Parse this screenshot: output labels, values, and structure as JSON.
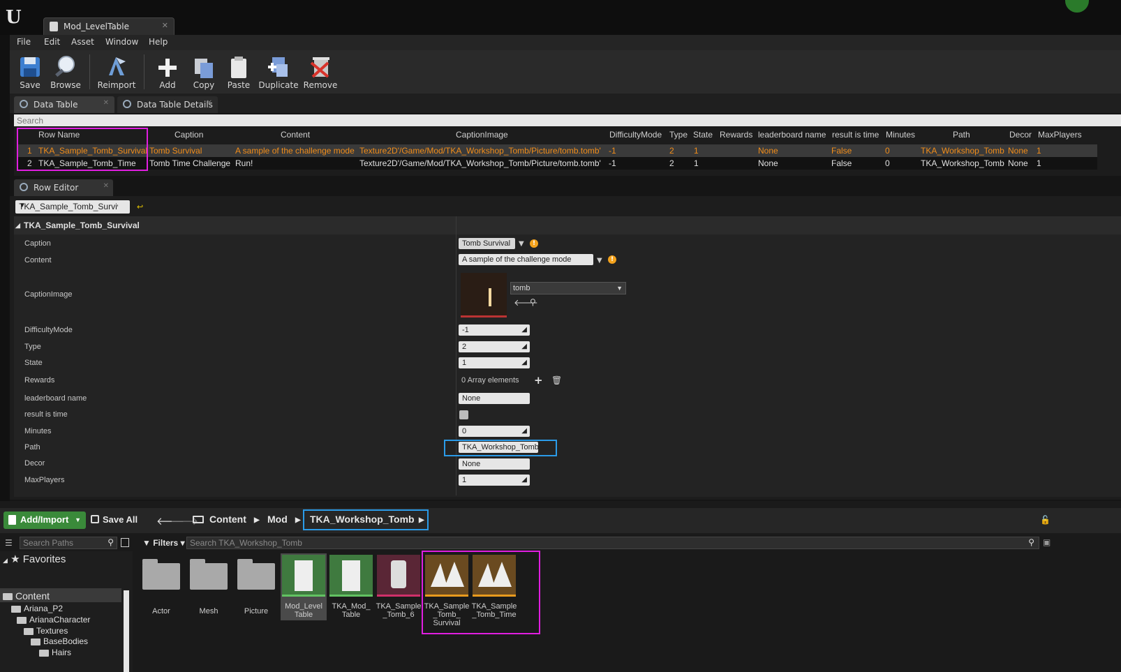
{
  "window": {
    "tab_title": "Mod_LevelTable",
    "logo": "U"
  },
  "menu": [
    "File",
    "Edit",
    "Asset",
    "Window",
    "Help"
  ],
  "toolbar": {
    "save": "Save",
    "browse": "Browse",
    "reimport": "Reimport",
    "add": "Add",
    "copy": "Copy",
    "paste": "Paste",
    "duplicate": "Duplicate",
    "remove": "Remove"
  },
  "panels": {
    "data_table": "Data Table",
    "data_table_details": "Data Table Details",
    "search_placeholder": "Search",
    "row_editor": "Row Editor"
  },
  "table": {
    "columns": [
      "Row Name",
      "Caption",
      "Content",
      "CaptionImage",
      "DifficultyMode",
      "Type",
      "State",
      "Rewards",
      "leaderboard name",
      "result is time",
      "Minutes",
      "Path",
      "Decor",
      "MaxPlayers"
    ],
    "rows": [
      [
        "1",
        "TKA_Sample_Tomb_Survival",
        "Tomb Survival",
        "A sample of the challenge mode",
        "Texture2D'/Game/Mod/TKA_Workshop_Tomb/Picture/tomb.tomb'",
        "-1",
        "2",
        "1",
        "None",
        "False",
        "0",
        "TKA_Workshop_Tomb",
        "None",
        "1"
      ],
      [
        "2",
        "TKA_Sample_Tomb_Time",
        "Tomb Time Challenge",
        "Run!",
        "Texture2D'/Game/Mod/TKA_Workshop_Tomb/Picture/tomb.tomb'",
        "-1",
        "2",
        "1",
        "None",
        "False",
        "0",
        "TKA_Workshop_Tomb",
        "None",
        "1"
      ]
    ]
  },
  "row_editor": {
    "selected_row": "TKA_Sample_Tomb_Survival",
    "section": "TKA_Sample_Tomb_Survival",
    "labels": {
      "caption": "Caption",
      "content": "Content",
      "caption_image": "CaptionImage",
      "difficulty": "DifficultyMode",
      "type": "Type",
      "state": "State",
      "rewards": "Rewards",
      "leaderboard": "leaderboard name",
      "result_time": "result is time",
      "minutes": "Minutes",
      "path": "Path",
      "decor": "Decor",
      "max_players": "MaxPlayers"
    },
    "values": {
      "caption": "Tomb Survival",
      "content": "A sample of the challenge mode",
      "caption_image": "tomb",
      "difficulty": "-1",
      "type": "2",
      "state": "1",
      "rewards": "0 Array elements",
      "leaderboard": "None",
      "result_time": false,
      "minutes": "0",
      "path": "TKA_Workshop_Tomb",
      "decor": "None",
      "max_players": "1"
    }
  },
  "content_browser": {
    "add_import": "Add/Import",
    "save_all": "Save All",
    "breadcrumbs": [
      "Content",
      "Mod",
      "TKA_Workshop_Tomb"
    ],
    "search_paths_placeholder": "Search Paths",
    "filters": "Filters",
    "search_assets_placeholder": "Search TKA_Workshop_Tomb",
    "favorites": "Favorites",
    "tree": [
      "Content",
      "Ariana_P2",
      "ArianaCharacter",
      "Textures",
      "BaseBodies",
      "Hairs"
    ],
    "assets": [
      "Actor",
      "Mesh",
      "Picture",
      "Mod_Level Table",
      "TKA_Mod_ Table",
      "TKA_Sample _Tomb_6",
      "TKA_Sample _Tomb_ Survival",
      "TKA_Sample _Tomb_Time"
    ]
  },
  "colors": {
    "accent_orange": "#f18d1a",
    "highlight_pink": "#e01ee0",
    "highlight_blue": "#2b9be8",
    "add_green": "#3a8a3a"
  }
}
